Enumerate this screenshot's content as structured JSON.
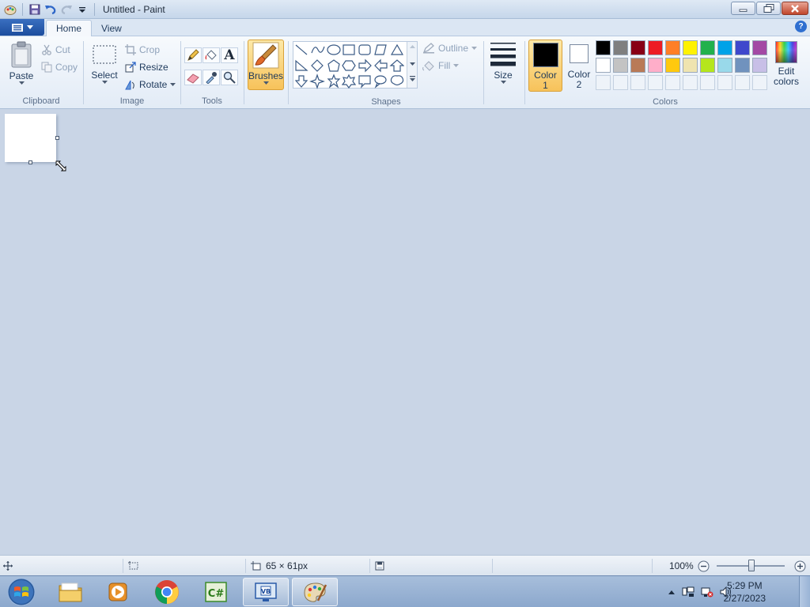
{
  "window": {
    "title": "Untitled - Paint"
  },
  "tabs": [
    {
      "label": "Home"
    },
    {
      "label": "View"
    }
  ],
  "ribbon": {
    "clipboard": {
      "label": "Clipboard",
      "paste": "Paste",
      "cut": "Cut",
      "copy": "Copy"
    },
    "image": {
      "label": "Image",
      "select": "Select",
      "crop": "Crop",
      "resize": "Resize",
      "rotate": "Rotate"
    },
    "tools": {
      "label": "Tools"
    },
    "brushes": {
      "label": "Brushes"
    },
    "shapes": {
      "label": "Shapes",
      "outline": "Outline",
      "fill": "Fill"
    },
    "size": {
      "label": "Size"
    },
    "colors": {
      "label": "Colors",
      "color1": "Color 1",
      "color1_line1": "Color",
      "color1_line2": "1",
      "color2_line1": "Color",
      "color2_line2": "2",
      "edit_line1": "Edit",
      "edit_line2": "colors",
      "color1_value": "#000000",
      "color2_value": "#ffffff",
      "palette_row1": [
        "#000000",
        "#7f7f7f",
        "#880015",
        "#ed1c24",
        "#ff7f27",
        "#fff200",
        "#22b14c",
        "#00a2e8",
        "#3f48cc",
        "#a349a4"
      ],
      "palette_row2": [
        "#ffffff",
        "#c3c3c3",
        "#b97a57",
        "#ffaec9",
        "#ffc90e",
        "#efe4b0",
        "#b5e61d",
        "#99d9ea",
        "#7092be",
        "#c8bfe7"
      ],
      "palette_row3_empty": 10
    }
  },
  "statusbar": {
    "canvas_size": "65 × 61px",
    "zoom": "100%"
  },
  "taskbar": {
    "apps": [
      "Start",
      "Windows Explorer",
      "Windows Media Player",
      "Google Chrome",
      "Visual C#",
      "Visual Basic",
      "Paint"
    ],
    "time": "5:29 PM",
    "date": "2/27/2023"
  }
}
